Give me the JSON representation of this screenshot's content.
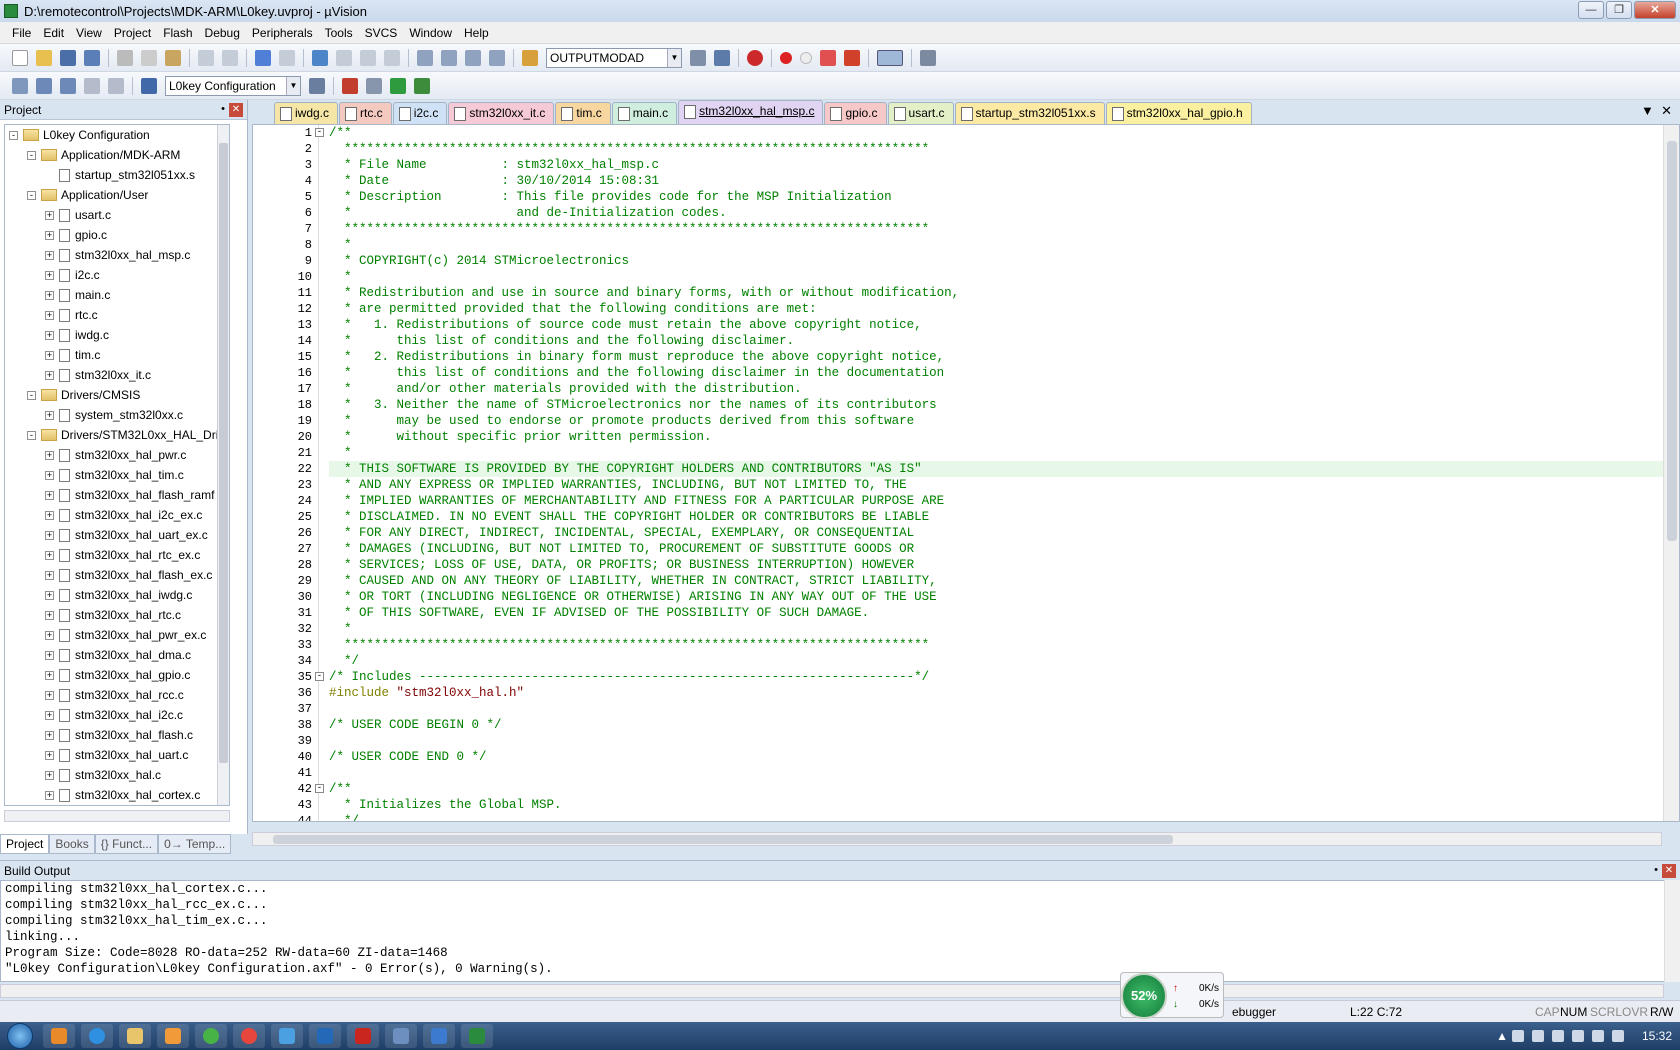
{
  "window": {
    "title": "D:\\remotecontrol\\Projects\\MDK-ARM\\L0key.uvproj - µVision"
  },
  "menu": [
    "File",
    "Edit",
    "View",
    "Project",
    "Flash",
    "Debug",
    "Peripherals",
    "Tools",
    "SVCS",
    "Window",
    "Help"
  ],
  "toolbar": {
    "find_combo": "OUTPUTMODAD",
    "target_combo": "L0key Configuration"
  },
  "project_panel": {
    "title": "Project",
    "tree": [
      {
        "label": "L0key Configuration",
        "level": 0,
        "type": "root",
        "exp": "-"
      },
      {
        "label": "Application/MDK-ARM",
        "level": 1,
        "type": "folder",
        "exp": "-"
      },
      {
        "label": "startup_stm32l051xx.s",
        "level": 2,
        "type": "file",
        "exp": ""
      },
      {
        "label": "Application/User",
        "level": 1,
        "type": "folder",
        "exp": "-"
      },
      {
        "label": "usart.c",
        "level": 2,
        "type": "file",
        "exp": "+"
      },
      {
        "label": "gpio.c",
        "level": 2,
        "type": "file",
        "exp": "+"
      },
      {
        "label": "stm32l0xx_hal_msp.c",
        "level": 2,
        "type": "file",
        "exp": "+"
      },
      {
        "label": "i2c.c",
        "level": 2,
        "type": "file",
        "exp": "+"
      },
      {
        "label": "main.c",
        "level": 2,
        "type": "file",
        "exp": "+"
      },
      {
        "label": "rtc.c",
        "level": 2,
        "type": "file",
        "exp": "+"
      },
      {
        "label": "iwdg.c",
        "level": 2,
        "type": "file",
        "exp": "+"
      },
      {
        "label": "tim.c",
        "level": 2,
        "type": "file",
        "exp": "+"
      },
      {
        "label": "stm32l0xx_it.c",
        "level": 2,
        "type": "file",
        "exp": "+"
      },
      {
        "label": "Drivers/CMSIS",
        "level": 1,
        "type": "folder",
        "exp": "-"
      },
      {
        "label": "system_stm32l0xx.c",
        "level": 2,
        "type": "file",
        "exp": "+"
      },
      {
        "label": "Drivers/STM32L0xx_HAL_Dri",
        "level": 1,
        "type": "folder",
        "exp": "-"
      },
      {
        "label": "stm32l0xx_hal_pwr.c",
        "level": 2,
        "type": "file",
        "exp": "+"
      },
      {
        "label": "stm32l0xx_hal_tim.c",
        "level": 2,
        "type": "file",
        "exp": "+"
      },
      {
        "label": "stm32l0xx_hal_flash_ramf",
        "level": 2,
        "type": "file",
        "exp": "+"
      },
      {
        "label": "stm32l0xx_hal_i2c_ex.c",
        "level": 2,
        "type": "file",
        "exp": "+"
      },
      {
        "label": "stm32l0xx_hal_uart_ex.c",
        "level": 2,
        "type": "file",
        "exp": "+"
      },
      {
        "label": "stm32l0xx_hal_rtc_ex.c",
        "level": 2,
        "type": "file",
        "exp": "+"
      },
      {
        "label": "stm32l0xx_hal_flash_ex.c",
        "level": 2,
        "type": "file",
        "exp": "+"
      },
      {
        "label": "stm32l0xx_hal_iwdg.c",
        "level": 2,
        "type": "file",
        "exp": "+"
      },
      {
        "label": "stm32l0xx_hal_rtc.c",
        "level": 2,
        "type": "file",
        "exp": "+"
      },
      {
        "label": "stm32l0xx_hal_pwr_ex.c",
        "level": 2,
        "type": "file",
        "exp": "+"
      },
      {
        "label": "stm32l0xx_hal_dma.c",
        "level": 2,
        "type": "file",
        "exp": "+"
      },
      {
        "label": "stm32l0xx_hal_gpio.c",
        "level": 2,
        "type": "file",
        "exp": "+"
      },
      {
        "label": "stm32l0xx_hal_rcc.c",
        "level": 2,
        "type": "file",
        "exp": "+"
      },
      {
        "label": "stm32l0xx_hal_i2c.c",
        "level": 2,
        "type": "file",
        "exp": "+"
      },
      {
        "label": "stm32l0xx_hal_flash.c",
        "level": 2,
        "type": "file",
        "exp": "+"
      },
      {
        "label": "stm32l0xx_hal_uart.c",
        "level": 2,
        "type": "file",
        "exp": "+"
      },
      {
        "label": "stm32l0xx_hal.c",
        "level": 2,
        "type": "file",
        "exp": "+"
      },
      {
        "label": "stm32l0xx_hal_cortex.c",
        "level": 2,
        "type": "file",
        "exp": "+"
      }
    ],
    "tabs": [
      "Project",
      "Books",
      "{} Funct...",
      "0→ Temp..."
    ]
  },
  "editor": {
    "tabs": [
      {
        "label": "iwdg.c",
        "color": "#f5e6a8"
      },
      {
        "label": "rtc.c",
        "color": "#f3c9c0"
      },
      {
        "label": "i2c.c",
        "color": "#cfe2f5"
      },
      {
        "label": "stm32l0xx_it.c",
        "color": "#f5c9d6"
      },
      {
        "label": "tim.c",
        "color": "#f8d6a0"
      },
      {
        "label": "main.c",
        "color": "#cfeede"
      },
      {
        "label": "stm32l0xx_hal_msp.c",
        "color": "#e0d4f2",
        "active": true
      },
      {
        "label": "gpio.c",
        "color": "#f7c8c8"
      },
      {
        "label": "usart.c",
        "color": "#e2efc7"
      },
      {
        "label": "startup_stm32l051xx.s",
        "color": "#fbe9a4"
      },
      {
        "label": "stm32l0xx_hal_gpio.h",
        "color": "#fbf0a0"
      }
    ],
    "lines": [
      "/**",
      "  ******************************************************************************",
      "  * File Name          : stm32l0xx_hal_msp.c",
      "  * Date               : 30/10/2014 15:08:31",
      "  * Description        : This file provides code for the MSP Initialization",
      "  *                      and de-Initialization codes.",
      "  ******************************************************************************",
      "  *",
      "  * COPYRIGHT(c) 2014 STMicroelectronics",
      "  *",
      "  * Redistribution and use in source and binary forms, with or without modification,",
      "  * are permitted provided that the following conditions are met:",
      "  *   1. Redistributions of source code must retain the above copyright notice,",
      "  *      this list of conditions and the following disclaimer.",
      "  *   2. Redistributions in binary form must reproduce the above copyright notice,",
      "  *      this list of conditions and the following disclaimer in the documentation",
      "  *      and/or other materials provided with the distribution.",
      "  *   3. Neither the name of STMicroelectronics nor the names of its contributors",
      "  *      may be used to endorse or promote products derived from this software",
      "  *      without specific prior written permission.",
      "  *",
      "  * THIS SOFTWARE IS PROVIDED BY THE COPYRIGHT HOLDERS AND CONTRIBUTORS \"AS IS\"",
      "  * AND ANY EXPRESS OR IMPLIED WARRANTIES, INCLUDING, BUT NOT LIMITED TO, THE",
      "  * IMPLIED WARRANTIES OF MERCHANTABILITY AND FITNESS FOR A PARTICULAR PURPOSE ARE",
      "  * DISCLAIMED. IN NO EVENT SHALL THE COPYRIGHT HOLDER OR CONTRIBUTORS BE LIABLE",
      "  * FOR ANY DIRECT, INDIRECT, INCIDENTAL, SPECIAL, EXEMPLARY, OR CONSEQUENTIAL",
      "  * DAMAGES (INCLUDING, BUT NOT LIMITED TO, PROCUREMENT OF SUBSTITUTE GOODS OR",
      "  * SERVICES; LOSS OF USE, DATA, OR PROFITS; OR BUSINESS INTERRUPTION) HOWEVER",
      "  * CAUSED AND ON ANY THEORY OF LIABILITY, WHETHER IN CONTRACT, STRICT LIABILITY,",
      "  * OR TORT (INCLUDING NEGLIGENCE OR OTHERWISE) ARISING IN ANY WAY OUT OF THE USE",
      "  * OF THIS SOFTWARE, EVEN IF ADVISED OF THE POSSIBILITY OF SUCH DAMAGE.",
      "  *",
      "  ******************************************************************************",
      "  */",
      "/* Includes ------------------------------------------------------------------*/",
      "#include \"stm32l0xx_hal.h\"",
      "",
      "/* USER CODE BEGIN 0 */",
      "",
      "/* USER CODE END 0 */",
      "",
      "/**",
      "  * Initializes the Global MSP.",
      "  */"
    ],
    "highlight_line": 22
  },
  "build_output": {
    "title": "Build Output",
    "lines": [
      "compiling stm32l0xx_hal_cortex.c...",
      "compiling stm32l0xx_hal_rcc_ex.c...",
      "compiling stm32l0xx_hal_tim_ex.c...",
      "linking...",
      "Program Size: Code=8028 RO-data=252 RW-data=60 ZI-data=1468",
      "\"L0key Configuration\\L0key Configuration.axf\" - 0 Error(s), 0 Warning(s)."
    ]
  },
  "status": {
    "debugger": "ebugger",
    "position": "L:22 C:72",
    "caps": "CAP",
    "num": "NUM",
    "scrl": "SCRL",
    "ovr": "OVR",
    "rw": "R/W"
  },
  "net_widget": {
    "percent": "52%",
    "up": "0K/s",
    "down": "0K/s"
  },
  "clock": "15:32"
}
